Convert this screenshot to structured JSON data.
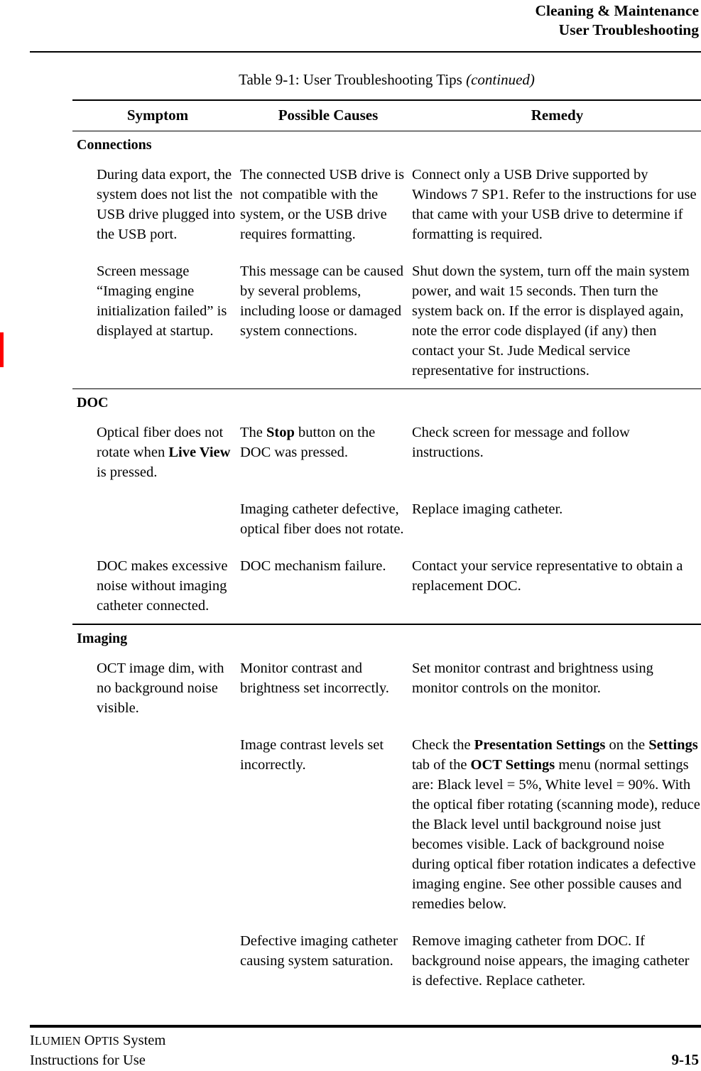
{
  "header": {
    "line1": "Cleaning & Maintenance",
    "line2": "User Troubleshooting"
  },
  "table_caption": {
    "main": "Table 9-1:  User Troubleshooting Tips ",
    "continued": "(continued)"
  },
  "table": {
    "columns": [
      "Symptom",
      "Possible Causes",
      "Remedy"
    ],
    "groups": [
      {
        "title": "Connections",
        "rows": [
          {
            "symptom": "During data export, the system does not list the USB drive plugged into the USB port.",
            "cause": "The connected USB drive is not compatible with the system, or the USB drive requires formatting.",
            "remedy": "Connect only a USB Drive supported by Windows 7 SP1. Refer to the instructions for use that came with your USB drive to determine if formatting is required."
          },
          {
            "symptom": "Screen message “Imaging engine initialization failed” is displayed at startup.",
            "cause": "This message can be caused by several problems, including loose or damaged system connections.",
            "remedy": "Shut down the system, turn off the main system power, and wait 15 seconds. Then turn the system back on. If the error is displayed again, note the error code displayed (if any) then contact your St. Jude Medical service representative for instructions."
          }
        ]
      },
      {
        "title": "DOC",
        "rows": [
          {
            "symptom_parts": [
              {
                "text": "Optical fiber does not rotate when ",
                "bold": false
              },
              {
                "text": "Live View",
                "bold": true
              },
              {
                "text": " is pressed.",
                "bold": false
              }
            ],
            "cause_parts": [
              {
                "text": "The ",
                "bold": false
              },
              {
                "text": "Stop",
                "bold": true
              },
              {
                "text": " button on the DOC was pressed.",
                "bold": false
              }
            ],
            "remedy": "Check screen for message and follow instructions."
          },
          {
            "symptom": "",
            "cause": "Imaging catheter defective, optical fiber does not rotate.",
            "remedy": "Replace imaging catheter."
          },
          {
            "symptom": "DOC makes excessive noise without imaging catheter connected.",
            "cause": "DOC mechanism failure.",
            "remedy": "Contact your service representative to obtain a replacement DOC."
          }
        ]
      },
      {
        "title": "Imaging",
        "rows": [
          {
            "symptom": "OCT image dim, with no background noise visible.",
            "cause": "Monitor contrast and brightness set incorrectly.",
            "remedy": "Set monitor contrast and brightness using monitor controls on the monitor."
          },
          {
            "symptom": "",
            "cause": "Image contrast levels set incorrectly.",
            "remedy_parts": [
              {
                "text": "Check the ",
                "bold": false
              },
              {
                "text": "Presentation Settings",
                "bold": true
              },
              {
                "text": " on the ",
                "bold": false
              },
              {
                "text": "Settings",
                "bold": true
              },
              {
                "text": " tab of the ",
                "bold": false
              },
              {
                "text": "OCT Settings",
                "bold": true
              },
              {
                "text": " menu (normal settings are:  Black level = 5%, White level = 90%. With the optical fiber rotating (scanning mode), reduce the Black level until background noise just becomes visible. Lack of background noise during optical fiber rotation indicates a defective imaging engine. See other possible causes and remedies below.",
                "bold": false
              }
            ]
          },
          {
            "symptom": "",
            "cause": "Defective imaging catheter causing system saturation.",
            "remedy": "Remove imaging catheter from DOC. If background noise appears, the imaging catheter is defective. Replace catheter."
          }
        ]
      }
    ]
  },
  "change_bar": {
    "color": "#fe0000"
  },
  "footer": {
    "product_caps_i": "I",
    "product_caps_lumien": "LUMIEN",
    "product_caps_o": " O",
    "product_caps_ptis": "PTIS",
    "product_system": " System",
    "line2": "Instructions for Use",
    "page_number": "9-15"
  }
}
